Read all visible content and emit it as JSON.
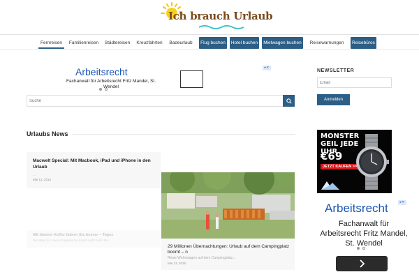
{
  "header": {
    "logo_text": "Ich brauch Urlaub"
  },
  "nav": {
    "items": [
      {
        "label": "Fernreisen"
      },
      {
        "label": "Familienreisen"
      },
      {
        "label": "Städtereisen"
      },
      {
        "label": "Kreuzfahrten"
      },
      {
        "label": "Badeurlaub"
      },
      {
        "label": "Flug buchen"
      },
      {
        "label": "Hotel buchen"
      },
      {
        "label": "Mietwagen buchen"
      },
      {
        "label": "Reisewarnungen"
      },
      {
        "label": "Reisebüros"
      }
    ]
  },
  "ad_top": {
    "title": "Arbeitsrecht",
    "subtitle": "Fachanwalt für Arbeitsrecht Fritz Mandel, St. Wendel"
  },
  "search": {
    "placeholder": "Suche"
  },
  "section": {
    "title": "Urlaubs News"
  },
  "posts": [
    {
      "title": "Macwelt Special: Mit Macbook, iPad und iPhone in den Urlaub",
      "excerpt": "...",
      "date": "Mai 13, 2016"
    },
    {
      "title": "29 Millionen Übernachtungen: Urlaub auf dem Campingplatz boomt – n",
      "excerpt": "Reise Wohnwagen auf dem Campingplatz...",
      "date": "Mai 13, 2016"
    },
    {
      "title": "Mit diesem Koffer fahren Sie besser – Tages",
      "excerpt": "Der Weg zur Luxus-Tragetasche kostet nicht mehr als..."
    }
  ],
  "newsletter": {
    "title": "NEWSLETTER",
    "email_placeholder": "Email",
    "button_label": "Anmelden"
  },
  "watch_ad": {
    "headline": "MONSTER GEIL JEDE UHR",
    "price": "€69",
    "cta": "JETZT KAUFEN >>"
  },
  "ad_side": {
    "title": "Arbeitsrecht",
    "subtitle": "Fachanwalt für Arbeitsrecht Fritz Mandel, St. Wendel"
  },
  "colors": {
    "brand_blue": "#2d5f86",
    "ad_blue": "#1a55b5"
  }
}
